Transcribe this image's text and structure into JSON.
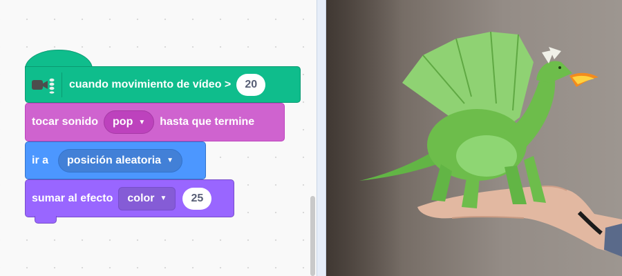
{
  "blocks": {
    "video_event": {
      "label": "cuando movimiento de vídeo >",
      "value": "20",
      "icon": "video-sensing-icon",
      "color": "#0fbd8c"
    },
    "play_sound": {
      "label_before": "tocar sonido",
      "sound": "pop",
      "label_after": "hasta que termine",
      "color": "#cf63cf"
    },
    "go_to": {
      "label": "ir a",
      "target": "posición aleatoria",
      "color": "#4c97ff"
    },
    "change_effect": {
      "label": "sumar al efecto",
      "effect": "color",
      "value": "25",
      "color": "#9966ff"
    }
  },
  "stage": {
    "sprite": "dragon",
    "background": "webcam-hand"
  }
}
